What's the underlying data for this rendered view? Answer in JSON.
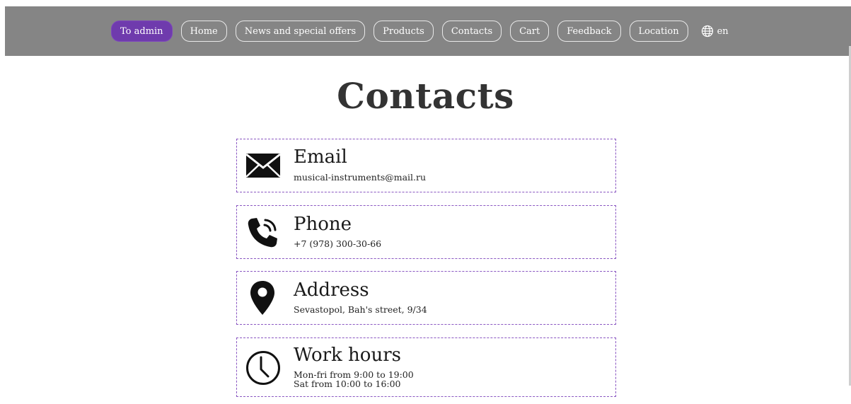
{
  "nav": {
    "items": [
      "To admin",
      "Home",
      "News and special offers",
      "Products",
      "Contacts",
      "Cart",
      "Feedback",
      "Location"
    ],
    "language": "en"
  },
  "page_title": "Contacts",
  "contacts": {
    "email": {
      "title": "Email",
      "value": "musical-instruments@mail.ru"
    },
    "phone": {
      "title": "Phone",
      "value": "+7 (978) 300-30-66"
    },
    "address": {
      "title": "Address",
      "value": "Sevastopol, Bah's street, 9/34"
    },
    "hours": {
      "title": "Work hours",
      "line1": "Mon-fri from 9:00 to 19:00",
      "line2": "Sat from 10:00 to 16:00"
    }
  },
  "colors": {
    "topbar": "#858585",
    "accent": "#6f3bad",
    "card_border": "#8a57c2"
  }
}
